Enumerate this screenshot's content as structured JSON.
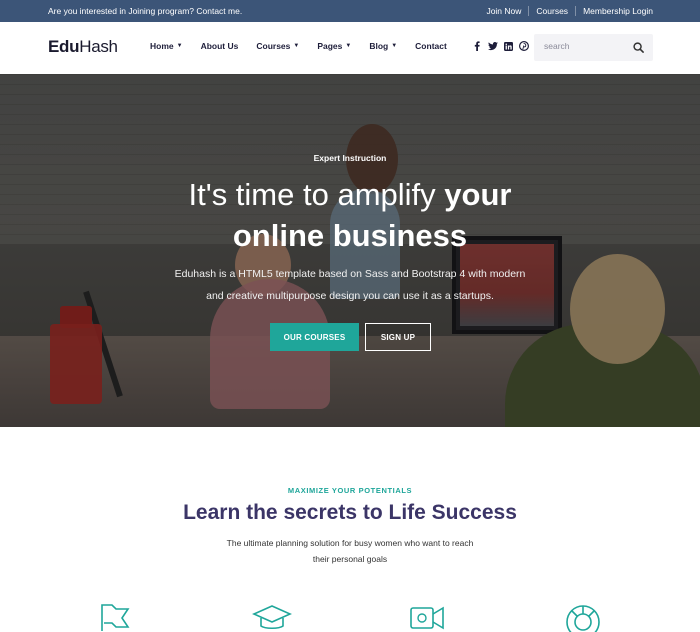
{
  "topbar": {
    "message": "Are you interested in Joining program? Contact me.",
    "links": [
      "Join Now",
      "Courses",
      "Membership Login"
    ]
  },
  "header": {
    "logo_bold": "Edu",
    "logo_rest": "Hash",
    "nav": [
      {
        "label": "Home",
        "dropdown": true
      },
      {
        "label": "About Us",
        "dropdown": false
      },
      {
        "label": "Courses",
        "dropdown": true
      },
      {
        "label": "Pages",
        "dropdown": true
      },
      {
        "label": "Blog",
        "dropdown": true
      },
      {
        "label": "Contact",
        "dropdown": false
      }
    ],
    "social_icons": [
      "facebook-icon",
      "twitter-icon",
      "linkedin-icon",
      "pinterest-icon"
    ],
    "search_placeholder": "search"
  },
  "hero": {
    "kicker": "Expert Instruction",
    "title_regular": "It's time to amplify ",
    "title_bold_1": "your",
    "title_bold_2": "online business",
    "description": "Eduhash is a HTML5 template based on Sass and Bootstrap 4 with modern and creative multipurpose design you can use it as a startups.",
    "primary_button": "OUR COURSES",
    "secondary_button": "SIGN UP"
  },
  "section": {
    "kicker": "MAXIMIZE YOUR POTENTIALS",
    "title": "Learn the secrets to Life Success",
    "subtitle_line1": "The ultimate planning solution for busy women who want to reach",
    "subtitle_line2": "their personal goals"
  },
  "colors": {
    "topbar": "#3c5578",
    "accent": "#1fa69a",
    "heading": "#3b3567",
    "nav_text": "#1e1e3a"
  }
}
